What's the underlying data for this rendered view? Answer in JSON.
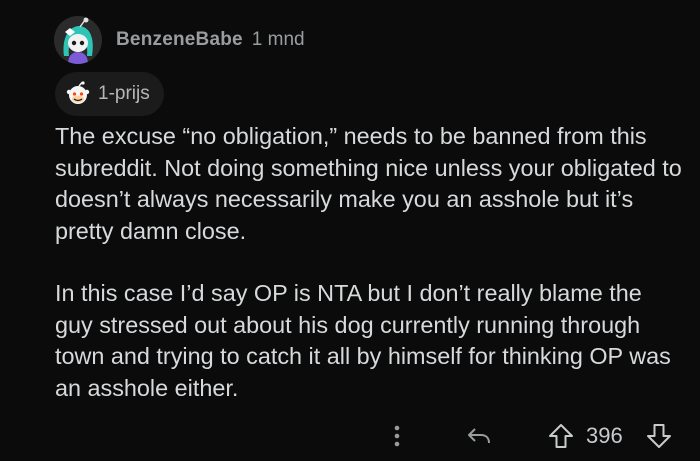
{
  "comment": {
    "author": "BenzeneBabe",
    "time": "1 mnd",
    "avatar_icon": "snoo-avatar-icon",
    "award": {
      "icon": "award-icon",
      "label": "1-prijs"
    },
    "paragraphs": [
      "The excuse “no obligation,” needs to be banned from this subreddit. Not doing something nice unless your obligated to doesn’t always necessarily make you an asshole but it’s pretty damn close.",
      "In this case I’d say OP is NTA but I don’t really blame the guy stressed out about his dog currently running through town and trying to catch it all by himself for thinking OP was an asshole either."
    ]
  },
  "actions": {
    "more_icon": "more-vertical-icon",
    "reply_icon": "reply-icon",
    "upvote_icon": "upvote-arrow-icon",
    "score": "396",
    "downvote_icon": "downvote-arrow-icon"
  },
  "colors": {
    "background": "#0b0b0b",
    "text": "#d7dadc",
    "meta": "#9a9d9f",
    "avatar_accent": "#37d6c8"
  }
}
